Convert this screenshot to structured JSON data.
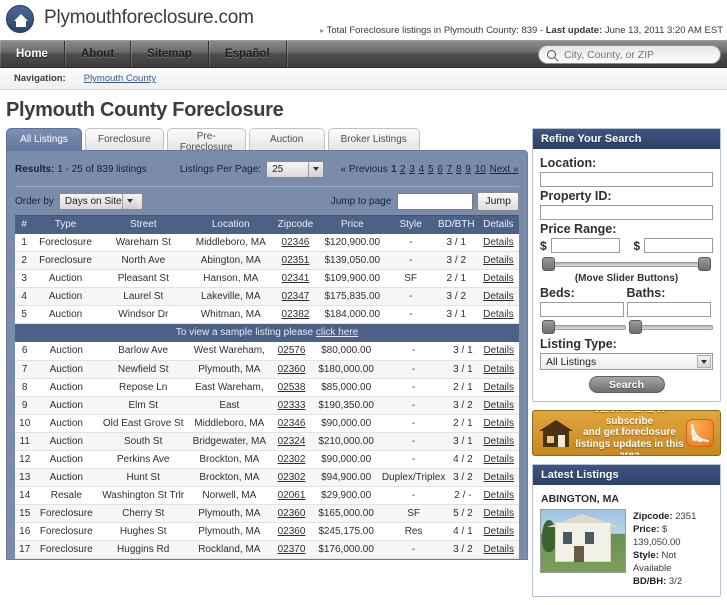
{
  "brand": {
    "name": "Plymouthforeclosure.com",
    "logo_icon": "house-in-circle-icon"
  },
  "header": {
    "total_listings_prefix": "Total Foreclosure listings in Plymouth County: 839 -",
    "last_update_label": "Last update:",
    "last_update_value": "June 13, 2011 3:20 AM EST"
  },
  "nav": {
    "items": [
      {
        "label": "Home",
        "active": true
      },
      {
        "label": "About",
        "active": false
      },
      {
        "label": "Sitemap",
        "active": false
      },
      {
        "label": "Español",
        "active": false
      }
    ],
    "search": {
      "placeholder": "City, County, or ZIP",
      "value": "",
      "icon": "search-icon"
    }
  },
  "breadcrumb": {
    "label": "Navigation:",
    "link": "Plymouth County"
  },
  "page": {
    "title": "Plymouth County Foreclosure"
  },
  "tabs": [
    {
      "label": "All Listings",
      "active": true
    },
    {
      "label": "Foreclosure",
      "active": false
    },
    {
      "label": "Pre-",
      "label2": "Foreclosure",
      "active": false
    },
    {
      "label": "Auction",
      "active": false
    },
    {
      "label": "Broker Listings",
      "active": false
    }
  ],
  "toolbar": {
    "results_label": "Results:",
    "results_text": "1 - 25 of 839 listings",
    "listings_per_page_label": "Listings Per Page:",
    "listings_per_page_value": "25",
    "previous_label": "« Previous",
    "pages": [
      "1",
      "2",
      "3",
      "4",
      "5",
      "6",
      "7",
      "8",
      "9",
      "10"
    ],
    "current_page": "1",
    "next_label": "Next »",
    "order_by_label": "Order by",
    "order_by_value": "Days on Site",
    "jump_to_page_label": "Jump to page",
    "jump_to_page_value": "",
    "jump_button": "Jump"
  },
  "table": {
    "columns": [
      "#",
      "Type",
      "Street",
      "Location",
      "Zipcode",
      "Price",
      "Style",
      "BD/BTH",
      "Details"
    ],
    "rows": [
      {
        "num": "1",
        "type": "Foreclosure",
        "street": "Wareham St",
        "location": "Middleboro, MA",
        "zip": "02346",
        "price": "$120,900.00",
        "style": "-",
        "bd": "3 / 1",
        "details": "Details"
      },
      {
        "num": "2",
        "type": "Foreclosure",
        "street": "North Ave",
        "location": "Abington, MA",
        "zip": "02351",
        "price": "$139,050.00",
        "style": "-",
        "bd": "3 / 2",
        "details": "Details"
      },
      {
        "num": "3",
        "type": "Auction",
        "street": "Pleasant St",
        "location": "Hanson, MA",
        "zip": "02341",
        "price": "$109,900.00",
        "style": "SF",
        "bd": "2 / 1",
        "details": "Details"
      },
      {
        "num": "4",
        "type": "Auction",
        "street": "Laurel St",
        "location": "Lakeville, MA",
        "zip": "02347",
        "price": "$175,835.00",
        "style": "-",
        "bd": "3 / 2",
        "details": "Details"
      },
      {
        "num": "5",
        "type": "Auction",
        "street": "Windsor Dr",
        "location": "Whitman, MA",
        "zip": "02382",
        "price": "$184,000.00",
        "style": "-",
        "bd": "3 / 1",
        "details": "Details"
      },
      {
        "num": "6",
        "type": "Auction",
        "street": "Barlow Ave",
        "location": "West Wareham,",
        "zip": "02576",
        "price": "$80,000.00",
        "style": "-",
        "bd": "3 / 1",
        "details": "Details"
      },
      {
        "num": "7",
        "type": "Auction",
        "street": "Newfield St",
        "location": "Plymouth, MA",
        "zip": "02360",
        "price": "$180,000.00",
        "style": "-",
        "bd": "3 / 1",
        "details": "Details"
      },
      {
        "num": "8",
        "type": "Auction",
        "street": "Repose Ln",
        "location": "East Wareham,",
        "zip": "02538",
        "price": "$85,000.00",
        "style": "-",
        "bd": "2 / 1",
        "details": "Details"
      },
      {
        "num": "9",
        "type": "Auction",
        "street": "Elm St",
        "location": "East",
        "zip": "02333",
        "price": "$190,350.00",
        "style": "-",
        "bd": "3 / 2",
        "details": "Details"
      },
      {
        "num": "10",
        "type": "Auction",
        "street": "Old East Grove St",
        "location": "Middleboro, MA",
        "zip": "02346",
        "price": "$90,000.00",
        "style": "-",
        "bd": "2 / 1",
        "details": "Details"
      },
      {
        "num": "11",
        "type": "Auction",
        "street": "South St",
        "location": "Bridgewater, MA",
        "zip": "02324",
        "price": "$210,000.00",
        "style": "-",
        "bd": "3 / 1",
        "details": "Details"
      },
      {
        "num": "12",
        "type": "Auction",
        "street": "Perkins Ave",
        "location": "Brockton, MA",
        "zip": "02302",
        "price": "$90,000.00",
        "style": "-",
        "bd": "4 / 2",
        "details": "Details"
      },
      {
        "num": "13",
        "type": "Auction",
        "street": "Hunt St",
        "location": "Brockton, MA",
        "zip": "02302",
        "price": "$94,900.00",
        "style": "Duplex/Triplex",
        "bd": "3 / 2",
        "details": "Details"
      },
      {
        "num": "14",
        "type": "Resale",
        "street": "Washington St Trlr",
        "location": "Norwell, MA",
        "zip": "02061",
        "price": "$29,900.00",
        "style": "-",
        "bd": "2 / -",
        "details": "Details"
      },
      {
        "num": "15",
        "type": "Foreclosure",
        "street": "Cherry St",
        "location": "Plymouth, MA",
        "zip": "02360",
        "price": "$165,000.00",
        "style": "SF",
        "bd": "5 / 2",
        "details": "Details"
      },
      {
        "num": "16",
        "type": "Foreclosure",
        "street": "Hughes St",
        "location": "Plymouth, MA",
        "zip": "02360",
        "price": "$245,175.00",
        "style": "Res",
        "bd": "4 / 1",
        "details": "Details"
      },
      {
        "num": "17",
        "type": "Foreclosure",
        "street": "Huggins Rd",
        "location": "Rockland, MA",
        "zip": "02370",
        "price": "$176,000.00",
        "style": "-",
        "bd": "3 / 2",
        "details": "Details"
      }
    ],
    "sample_bar_text": "To view a sample listing please ",
    "sample_bar_link": "click here"
  },
  "refine": {
    "title": "Refine Your Search",
    "location_label": "Location:",
    "location_value": "",
    "property_id_label": "Property ID:",
    "property_id_value": "",
    "price_range_label": "Price Range:",
    "price_min": "",
    "price_max": "",
    "dollar_sign": "$",
    "slider_hint": "(Move Slider Buttons)",
    "beds_label": "Beds:",
    "beds_value": "",
    "baths_label": "Baths:",
    "baths_value": "",
    "listing_type_label": "Listing Type:",
    "listing_type_value": "All Listings",
    "search_button": "Search"
  },
  "rss_banner": {
    "line1": "CLICK HERE to subscribe",
    "line2": "and get foreclosure",
    "line3": "listings updates in this area",
    "house_icon": "house-icon",
    "rss_icon": "rss-icon"
  },
  "latest": {
    "title": "Latest Listings",
    "city": "ABINGTON, MA",
    "photo_icon": "property-photo",
    "zipcode_label": "Zipcode:",
    "zipcode_value": "2351",
    "price_label": "Price:",
    "price_value": "$ 139,050.00",
    "style_label": "Style:",
    "style_value": "Not Available",
    "bdbh_label": "BD/BH:",
    "bdbh_value": "3/2"
  },
  "colors": {
    "panel_blue": "#7b8cab",
    "table_header": "#4d6086",
    "sidebar_header": "#2c4168",
    "banner_orange": "#c8871f",
    "link": "#3a5a8c"
  }
}
